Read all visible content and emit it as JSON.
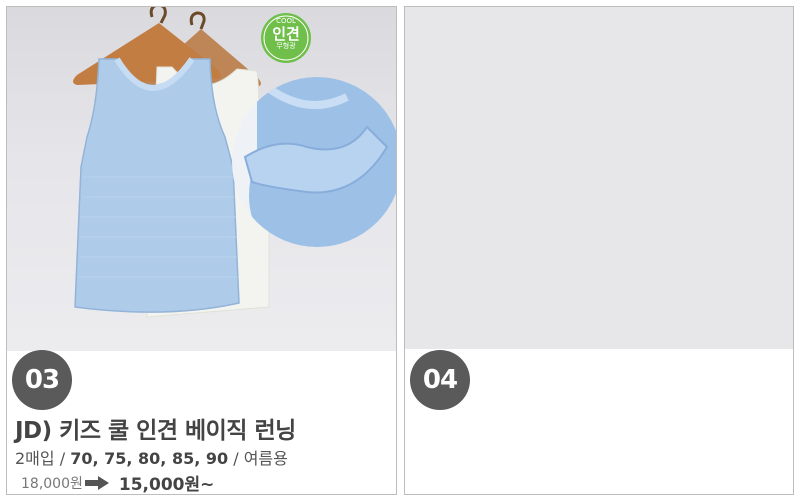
{
  "products": [
    {
      "number": "03",
      "title": "JD) 키즈 쿨 인견 베이직 런닝",
      "pack": "2매입 /",
      "sizes": "70, 75, 80, 85, 90",
      "season": "/ 여름용",
      "original_price": "18,000원",
      "sale_price": "15,000원~",
      "cool_badge": {
        "top": "COOL",
        "main": "인견",
        "bottom": "무형광"
      },
      "image_subject": "light-blue sleeveless kids tank top on wooden hanger",
      "colors": {
        "shirt": "#aecbea",
        "badge": "#6fbf4a"
      }
    },
    {
      "number": "04"
    }
  ],
  "colors": {
    "badge_bg": "#5a5a5a",
    "border": "#bdbdbd"
  }
}
